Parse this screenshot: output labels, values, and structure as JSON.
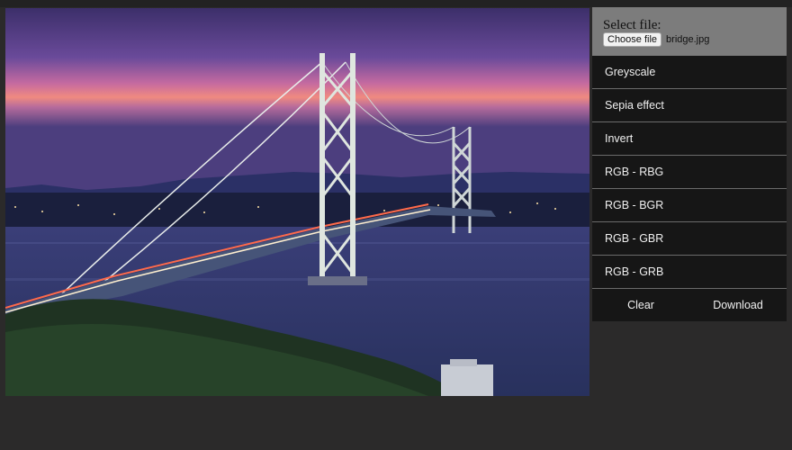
{
  "image": {
    "description_icon": "photo-icon"
  },
  "file": {
    "label": "Select file:",
    "button": "Choose file",
    "filename": "bridge.jpg"
  },
  "menu": [
    {
      "label": "Greyscale"
    },
    {
      "label": "Sepia effect"
    },
    {
      "label": "Invert"
    },
    {
      "label": "RGB - RBG"
    },
    {
      "label": "RGB - BGR"
    },
    {
      "label": "RGB - GBR"
    },
    {
      "label": "RGB - GRB"
    }
  ],
  "actions": {
    "clear": "Clear",
    "download": "Download"
  },
  "colors": {
    "background": "#2b2a2a",
    "panel_item": "#161616",
    "file_box": "#7c7c7c"
  }
}
